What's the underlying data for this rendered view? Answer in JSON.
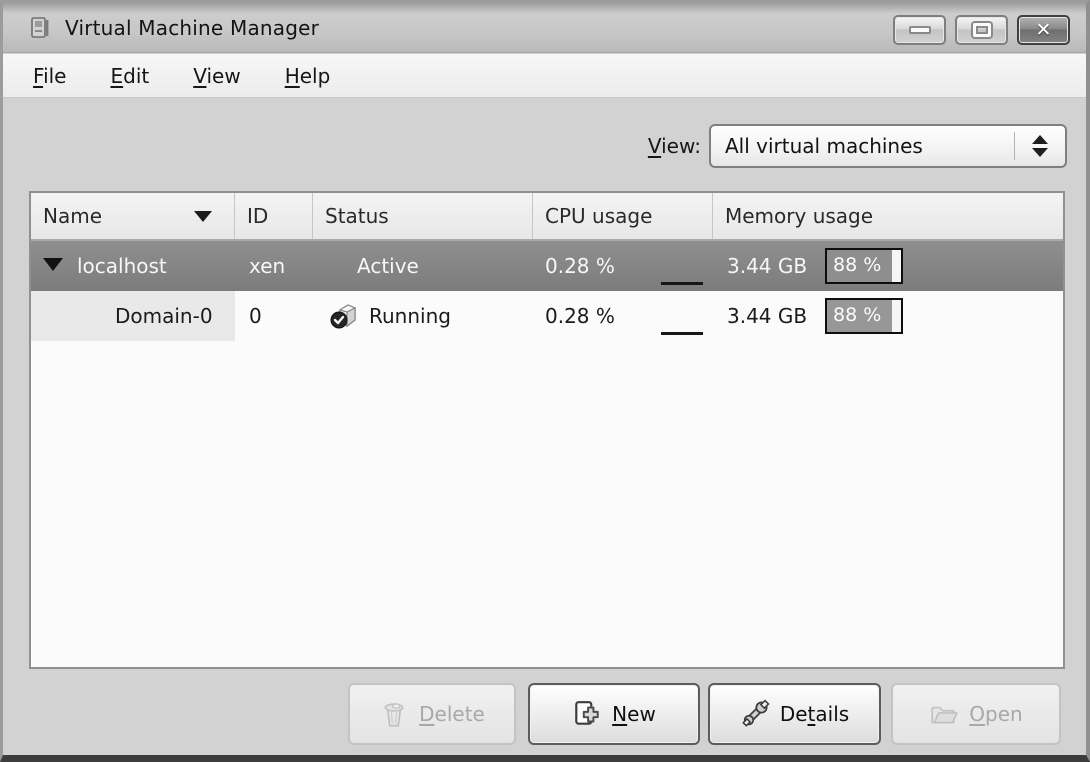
{
  "window": {
    "title": "Virtual Machine Manager"
  },
  "menubar": {
    "items": [
      {
        "pre": "",
        "u": "F",
        "post": "ile"
      },
      {
        "pre": "",
        "u": "E",
        "post": "dit"
      },
      {
        "pre": "",
        "u": "V",
        "post": "iew"
      },
      {
        "pre": "",
        "u": "H",
        "post": "elp"
      }
    ]
  },
  "view_filter": {
    "label_u": "V",
    "label_post": "iew:",
    "value": "All virtual machines"
  },
  "vm_table": {
    "headers": [
      {
        "label": "Name",
        "sorted": "desc"
      },
      {
        "label": "ID"
      },
      {
        "label": "Status"
      },
      {
        "label": "CPU usage"
      },
      {
        "label": "Memory usage"
      }
    ],
    "rows": [
      {
        "name": "localhost",
        "id": "xen",
        "status": "Active",
        "cpu": "0.28 %",
        "memory": "3.44 GB",
        "mem_percent_label": "88 %",
        "mem_percent": 88,
        "selected": true,
        "expanded": true
      },
      {
        "name": "Domain-0",
        "id": "0",
        "status": "Running",
        "cpu": "0.28 %",
        "memory": "3.44 GB",
        "mem_percent_label": "88 %",
        "mem_percent": 88,
        "selected": false,
        "expanded": false
      }
    ]
  },
  "action_buttons": [
    {
      "pre": "",
      "u": "D",
      "post": "elete",
      "icon": "trash-icon",
      "enabled": false
    },
    {
      "pre": "",
      "u": "N",
      "post": "ew",
      "icon": "new-vm-icon",
      "enabled": true
    },
    {
      "pre": "De",
      "u": "t",
      "post": "ails",
      "icon": "wrench-icon",
      "enabled": true
    },
    {
      "pre": "",
      "u": "O",
      "post": "pen",
      "icon": "folder-icon",
      "enabled": false
    }
  ]
}
